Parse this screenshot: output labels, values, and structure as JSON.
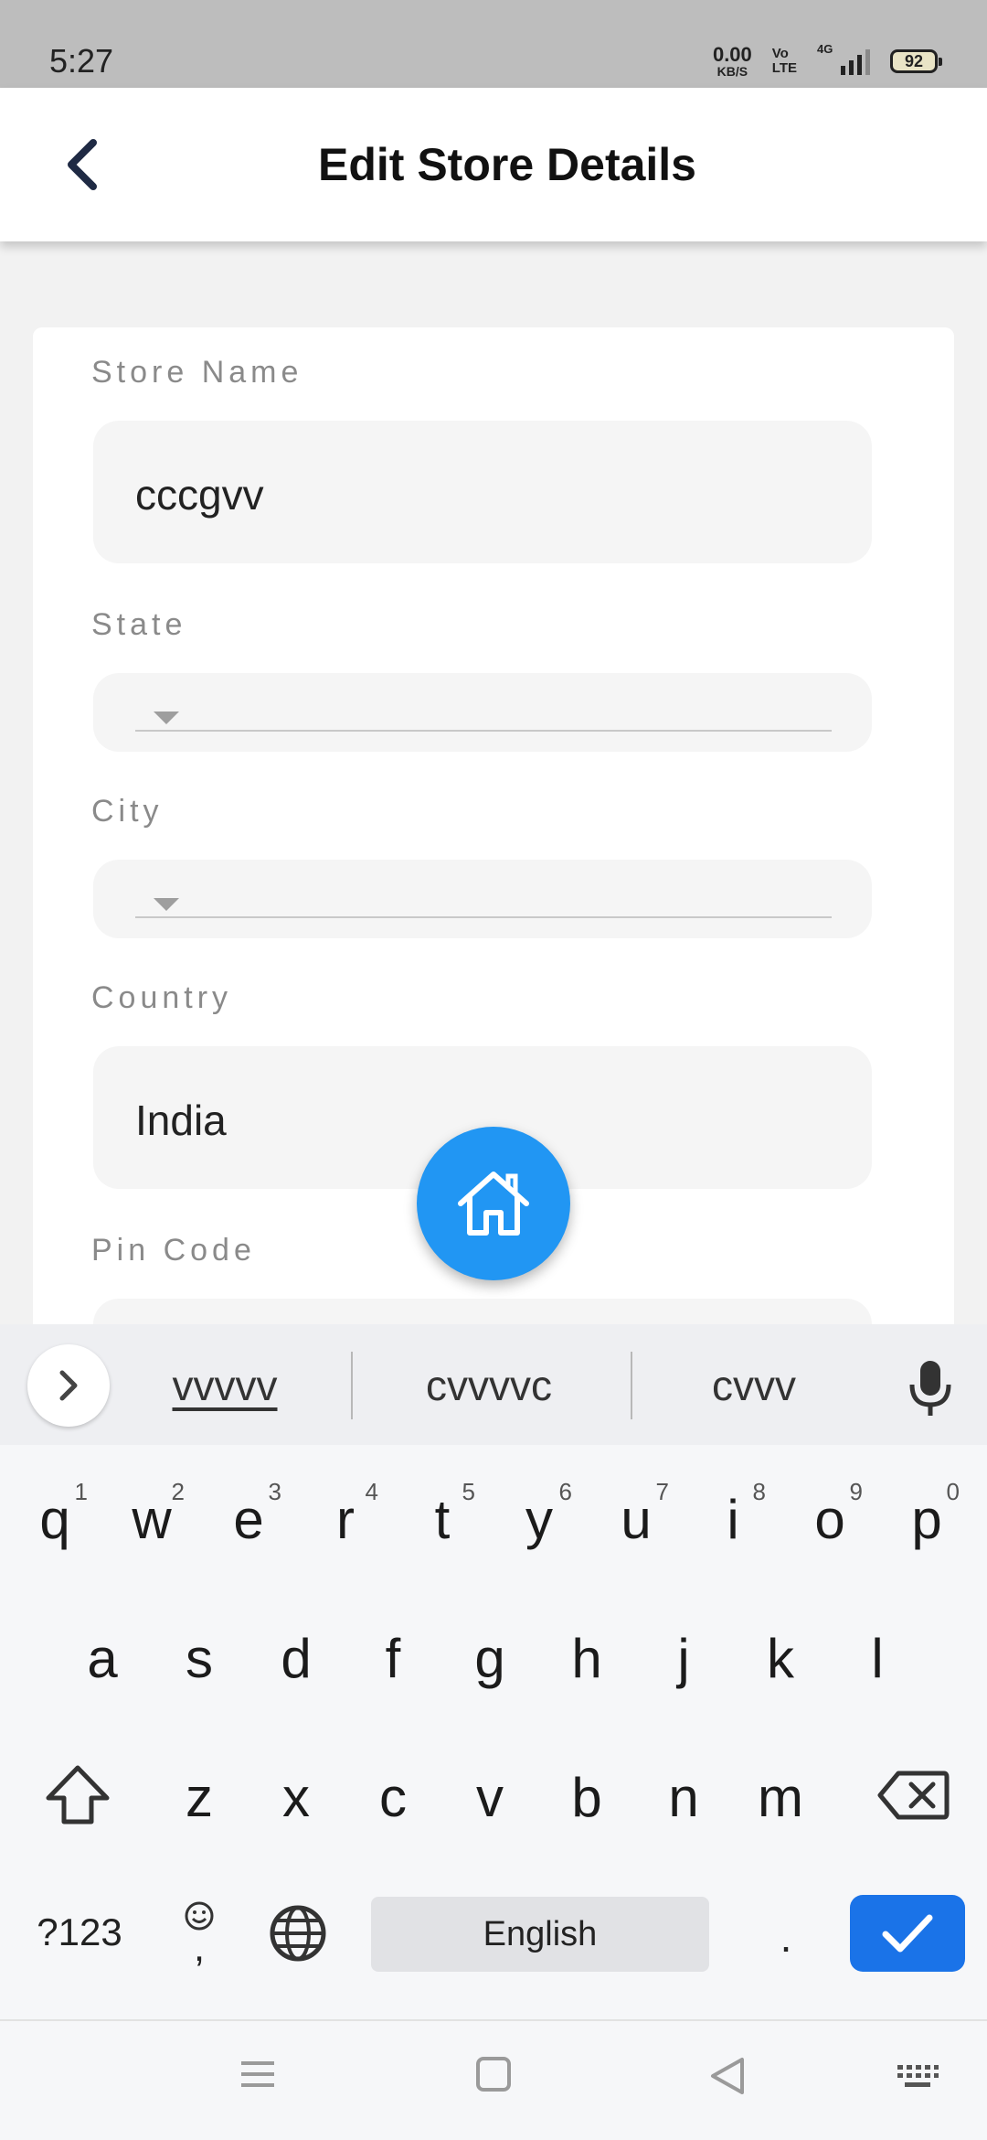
{
  "status_bar": {
    "time": "5:27",
    "net_speed_value": "0.00",
    "net_speed_unit": "KB/S",
    "volte_top": "Vo",
    "volte_bottom": "LTE",
    "network": "4G",
    "battery": "92"
  },
  "app_bar": {
    "title": "Edit Store Details",
    "back_icon": "chevron-left-icon"
  },
  "form": {
    "store_name": {
      "label": "Store Name",
      "value": "cccgvv"
    },
    "state": {
      "label": "State",
      "value": ""
    },
    "city": {
      "label": "City",
      "value": ""
    },
    "country": {
      "label": "Country",
      "value": "India"
    },
    "pin_code": {
      "label": "Pin Code",
      "value": ""
    }
  },
  "fab": {
    "icon": "home-icon",
    "color": "#2196f3"
  },
  "keyboard": {
    "suggestions": [
      "vvvvv",
      "cvvvvc",
      "cvvv"
    ],
    "row1": [
      {
        "key": "q",
        "hint": "1"
      },
      {
        "key": "w",
        "hint": "2"
      },
      {
        "key": "e",
        "hint": "3"
      },
      {
        "key": "r",
        "hint": "4"
      },
      {
        "key": "t",
        "hint": "5"
      },
      {
        "key": "y",
        "hint": "6"
      },
      {
        "key": "u",
        "hint": "7"
      },
      {
        "key": "i",
        "hint": "8"
      },
      {
        "key": "o",
        "hint": "9"
      },
      {
        "key": "p",
        "hint": "0"
      }
    ],
    "row2": [
      "a",
      "s",
      "d",
      "f",
      "g",
      "h",
      "j",
      "k",
      "l"
    ],
    "row3": [
      "z",
      "x",
      "c",
      "v",
      "b",
      "n",
      "m"
    ],
    "symbols_key": "?123",
    "comma_key": ",",
    "space_label": "English",
    "period_key": ".",
    "accent_color": "#1a73e8"
  },
  "nav_bar": {
    "icons": [
      "menu-icon",
      "home-square-icon",
      "back-triangle-icon",
      "keyboard-icon"
    ]
  }
}
